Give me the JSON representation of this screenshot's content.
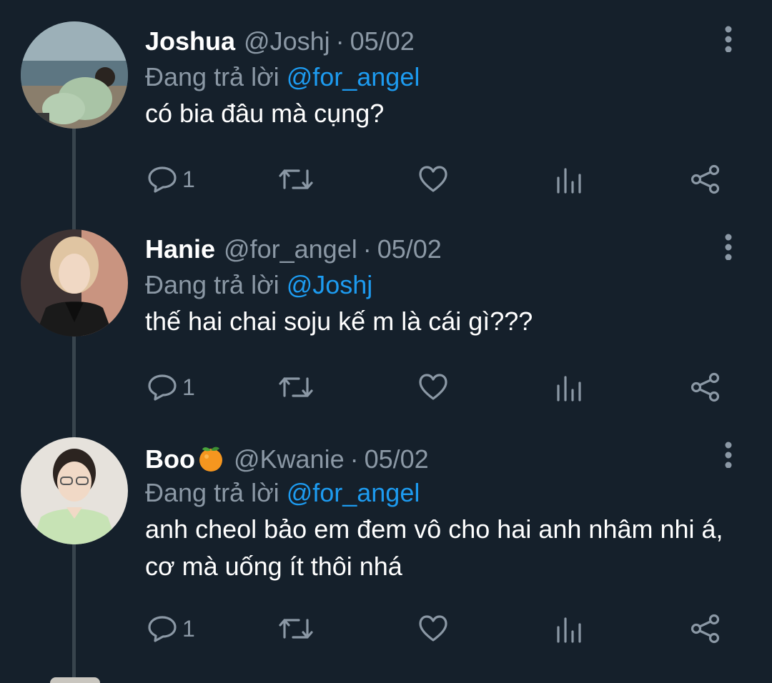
{
  "tweets": [
    {
      "name": "Joshua",
      "emoji": "",
      "handle": "@Joshj",
      "separator": "·",
      "date": "05/02",
      "reply_prefix": "Đang trả lời",
      "reply_to": "@for_angel",
      "text": "có bia đâu mà cụng?",
      "reply_count": "1"
    },
    {
      "name": "Hanie",
      "emoji": "",
      "handle": "@for_angel",
      "separator": "·",
      "date": "05/02",
      "reply_prefix": "Đang trả lời",
      "reply_to": "@Joshj",
      "text": "thế hai chai soju kế m là cái gì???",
      "reply_count": "1"
    },
    {
      "name": "Boo",
      "emoji": "tangerine-emoji",
      "handle": "@Kwanie",
      "separator": "·",
      "date": "05/02",
      "reply_prefix": "Đang trả lời",
      "reply_to": "@for_angel",
      "text": "anh cheol bảo em đem vô cho hai anh nhâm nhi á, cơ mà uống ít thôi nhá",
      "reply_count": "1"
    }
  ],
  "icons": {
    "reply": "reply-icon",
    "retweet": "retweet-icon",
    "like": "like-icon",
    "views": "views-icon",
    "share": "share-icon",
    "more": "more-vertical-icon"
  },
  "colors": {
    "background": "#15202b",
    "primary_text": "#ffffff",
    "secondary_text": "#8b98a5",
    "link": "#1d9bf0",
    "thread_line": "#38444d"
  }
}
